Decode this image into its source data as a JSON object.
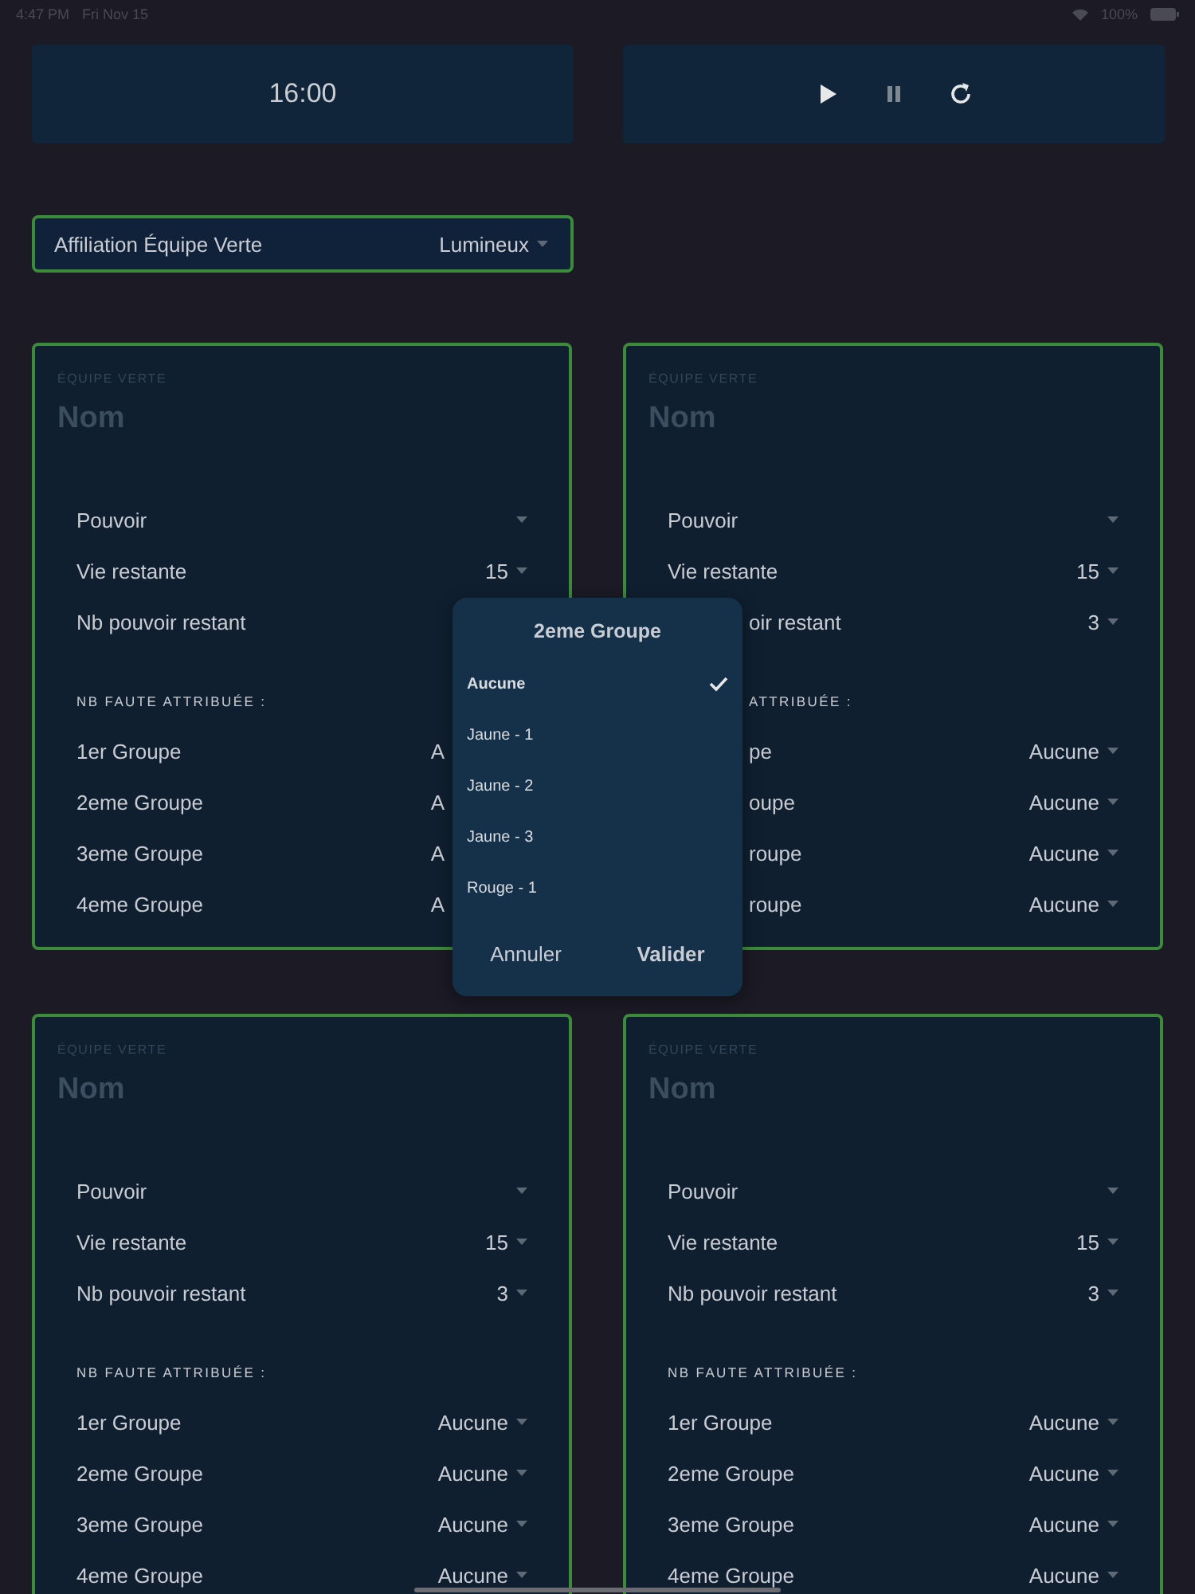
{
  "status_bar": {
    "time": "4:47 PM",
    "date": "Fri Nov 15",
    "battery": "100%"
  },
  "timer": {
    "display": "16:00"
  },
  "controls": [
    {
      "kind": "play"
    },
    {
      "kind": "pause"
    },
    {
      "kind": "restart"
    }
  ],
  "affiliation": {
    "label": "Affiliation Équipe Verte",
    "value": "Lumineux"
  },
  "cards": [
    {
      "team": "ÉQUIPE VERTE",
      "name_placeholder": "Nom",
      "fields": [
        {
          "kind": "plain",
          "label": "Pouvoir"
        },
        {
          "kind": "plain",
          "label": "Vie restante",
          "value": "15"
        },
        {
          "kind": "covered_value",
          "label": "Nb pouvoir restant"
        }
      ],
      "section": {
        "kind": "plain",
        "text": "NB FAUTE ATTRIBUÉE :"
      },
      "groups": [
        {
          "kind": "covered_value",
          "label": "1er Groupe",
          "value": "A"
        },
        {
          "kind": "covered_value",
          "label": "2eme Groupe",
          "value": "A"
        },
        {
          "kind": "covered_value",
          "label": "3eme Groupe",
          "value": "A"
        },
        {
          "kind": "covered_value",
          "label": "4eme Groupe",
          "value": "A"
        }
      ]
    },
    {
      "team": "ÉQUIPE VERTE",
      "name_placeholder": "Nom",
      "fields": [
        {
          "kind": "plain",
          "label": "Pouvoir"
        },
        {
          "kind": "plain",
          "label": "Vie restante",
          "value": "15"
        },
        {
          "kind": "covered_label",
          "label": "oir restant",
          "value": "3"
        }
      ],
      "section": {
        "kind": "covered",
        "text": "ATTRIBUÉE :"
      },
      "groups": [
        {
          "kind": "covered_label",
          "label": "pe",
          "value": "Aucune"
        },
        {
          "kind": "covered_label",
          "label": "oupe",
          "value": "Aucune"
        },
        {
          "kind": "covered_label",
          "label": "roupe",
          "value": "Aucune"
        },
        {
          "kind": "covered_label",
          "label": "roupe",
          "value": "Aucune"
        }
      ]
    },
    {
      "team": "ÉQUIPE VERTE",
      "name_placeholder": "Nom",
      "fields": [
        {
          "kind": "plain",
          "label": "Pouvoir"
        },
        {
          "kind": "plain",
          "label": "Vie restante",
          "value": "15"
        },
        {
          "kind": "plain",
          "label": "Nb pouvoir restant",
          "value": "3"
        }
      ],
      "section": {
        "kind": "plain",
        "text": "NB FAUTE ATTRIBUÉE :"
      },
      "groups": [
        {
          "kind": "plain",
          "label": "1er Groupe",
          "value": "Aucune"
        },
        {
          "kind": "plain",
          "label": "2eme Groupe",
          "value": "Aucune"
        },
        {
          "kind": "plain",
          "label": "3eme Groupe",
          "value": "Aucune"
        },
        {
          "kind": "plain",
          "label": "4eme Groupe",
          "value": "Aucune"
        }
      ]
    },
    {
      "team": "ÉQUIPE VERTE",
      "name_placeholder": "Nom",
      "fields": [
        {
          "kind": "plain",
          "label": "Pouvoir"
        },
        {
          "kind": "plain",
          "label": "Vie restante",
          "value": "15"
        },
        {
          "kind": "plain",
          "label": "Nb pouvoir restant",
          "value": "3"
        }
      ],
      "section": {
        "kind": "plain",
        "text": "NB FAUTE ATTRIBUÉE :"
      },
      "groups": [
        {
          "kind": "plain",
          "label": "1er Groupe",
          "value": "Aucune"
        },
        {
          "kind": "plain",
          "label": "2eme Groupe",
          "value": "Aucune"
        },
        {
          "kind": "plain",
          "label": "3eme Groupe",
          "value": "Aucune"
        },
        {
          "kind": "plain",
          "label": "4eme Groupe",
          "value": "Aucune"
        }
      ]
    }
  ],
  "picker": {
    "title": "2eme Groupe",
    "options": [
      {
        "label": "Aucune",
        "selected": true
      },
      {
        "label": "Jaune - 1",
        "selected": false
      },
      {
        "label": "Jaune - 2",
        "selected": false
      },
      {
        "label": "Jaune - 3",
        "selected": false
      },
      {
        "label": "Rouge - 1",
        "selected": false
      }
    ],
    "cancel": "Annuler",
    "confirm": "Valider"
  }
}
